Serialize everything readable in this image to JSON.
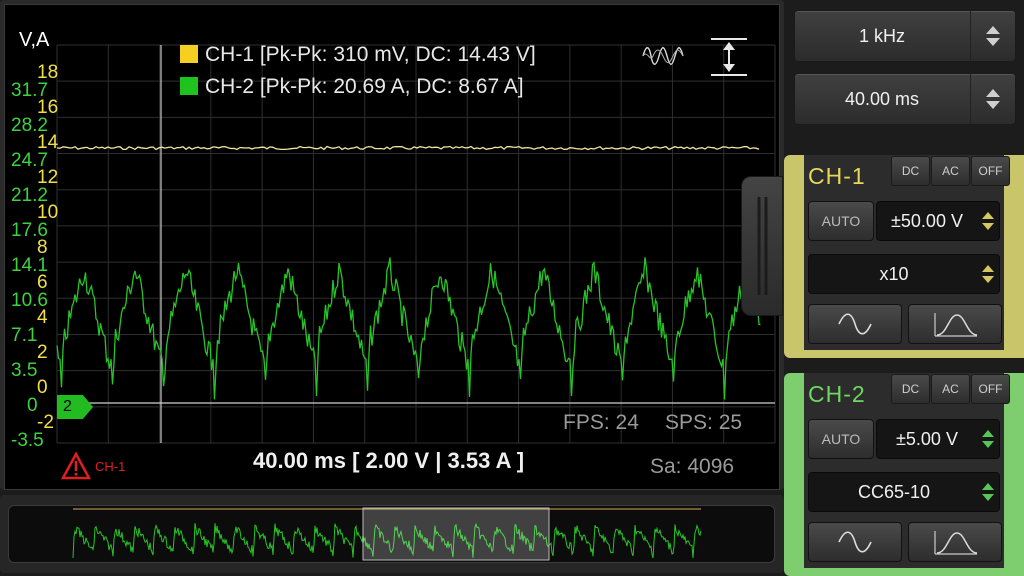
{
  "scope": {
    "units_label": "V,A",
    "y_axis_ch1": [
      "18",
      "16",
      "14",
      "12",
      "10",
      "8",
      "6",
      "4",
      "2",
      "0",
      "-2"
    ],
    "y_axis_ch2": [
      "31.7",
      "28.2",
      "24.7",
      "21.2",
      "17.6",
      "14.1",
      "10.6",
      "7.1",
      "3.5",
      "0",
      "-3.5"
    ],
    "legend": [
      {
        "text": "CH-1 [Pk-Pk: 310 mV, DC: 14.43 V]",
        "color": "#f5d020"
      },
      {
        "text": "CH-2 [Pk-Pk: 20.69 A, DC: 8.67 A]",
        "color": "#1fc21f"
      }
    ],
    "fps_text": "FPS: 24",
    "sps_text": "SPS: 25",
    "timebase_text": "40.00 ms  [ 2.00 V | 3.53 A ]",
    "samples_text": "Sa: 4096",
    "trigger_warning": "CH-1",
    "ch2_marker": "2",
    "icons": {
      "wave": "waveform-icon",
      "autoscale": "vertical-expand-icon",
      "warn": "warning-triangle-icon"
    }
  },
  "controls": {
    "frequency": "1 kHz",
    "timebase": "40.00 ms"
  },
  "channels": [
    {
      "title": "CH-1",
      "coupling": [
        "DC",
        "AC",
        "OFF"
      ],
      "auto": "AUTO",
      "range": "±50.00 V",
      "probe": "x10",
      "color": "#e6d85a"
    },
    {
      "title": "CH-2",
      "coupling": [
        "DC",
        "AC",
        "OFF"
      ],
      "auto": "AUTO",
      "range": "±5.00 V",
      "probe": "CC65-10",
      "color": "#6ed860"
    }
  ]
}
